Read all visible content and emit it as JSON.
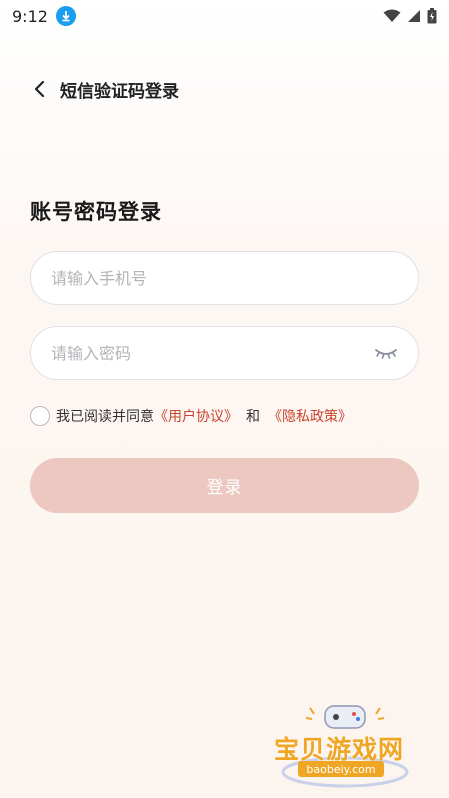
{
  "status_bar": {
    "time": "9:12"
  },
  "nav": {
    "title": "短信验证码登录"
  },
  "page": {
    "title": "账号密码登录"
  },
  "form": {
    "phone_placeholder": "请输入手机号",
    "password_placeholder": "请输入密码",
    "phone_value": "",
    "password_value": ""
  },
  "agreement": {
    "prefix": "我已阅读并同意",
    "user_agreement": "《用户协议》",
    "and": "和",
    "privacy_policy": "《隐私政策》",
    "checked": false
  },
  "login_button": {
    "label": "登录"
  },
  "watermark": {
    "text": "宝贝游戏网",
    "url": "baobeiy.com"
  },
  "colors": {
    "accent": "#c8452d",
    "button_disabled": "#edc8c0",
    "download_badge": "#1a9cf0",
    "watermark": "#f0a625"
  },
  "icons": [
    "download-icon",
    "wifi-icon",
    "signal-icon",
    "battery-icon",
    "back-icon",
    "eye-closed-icon"
  ]
}
